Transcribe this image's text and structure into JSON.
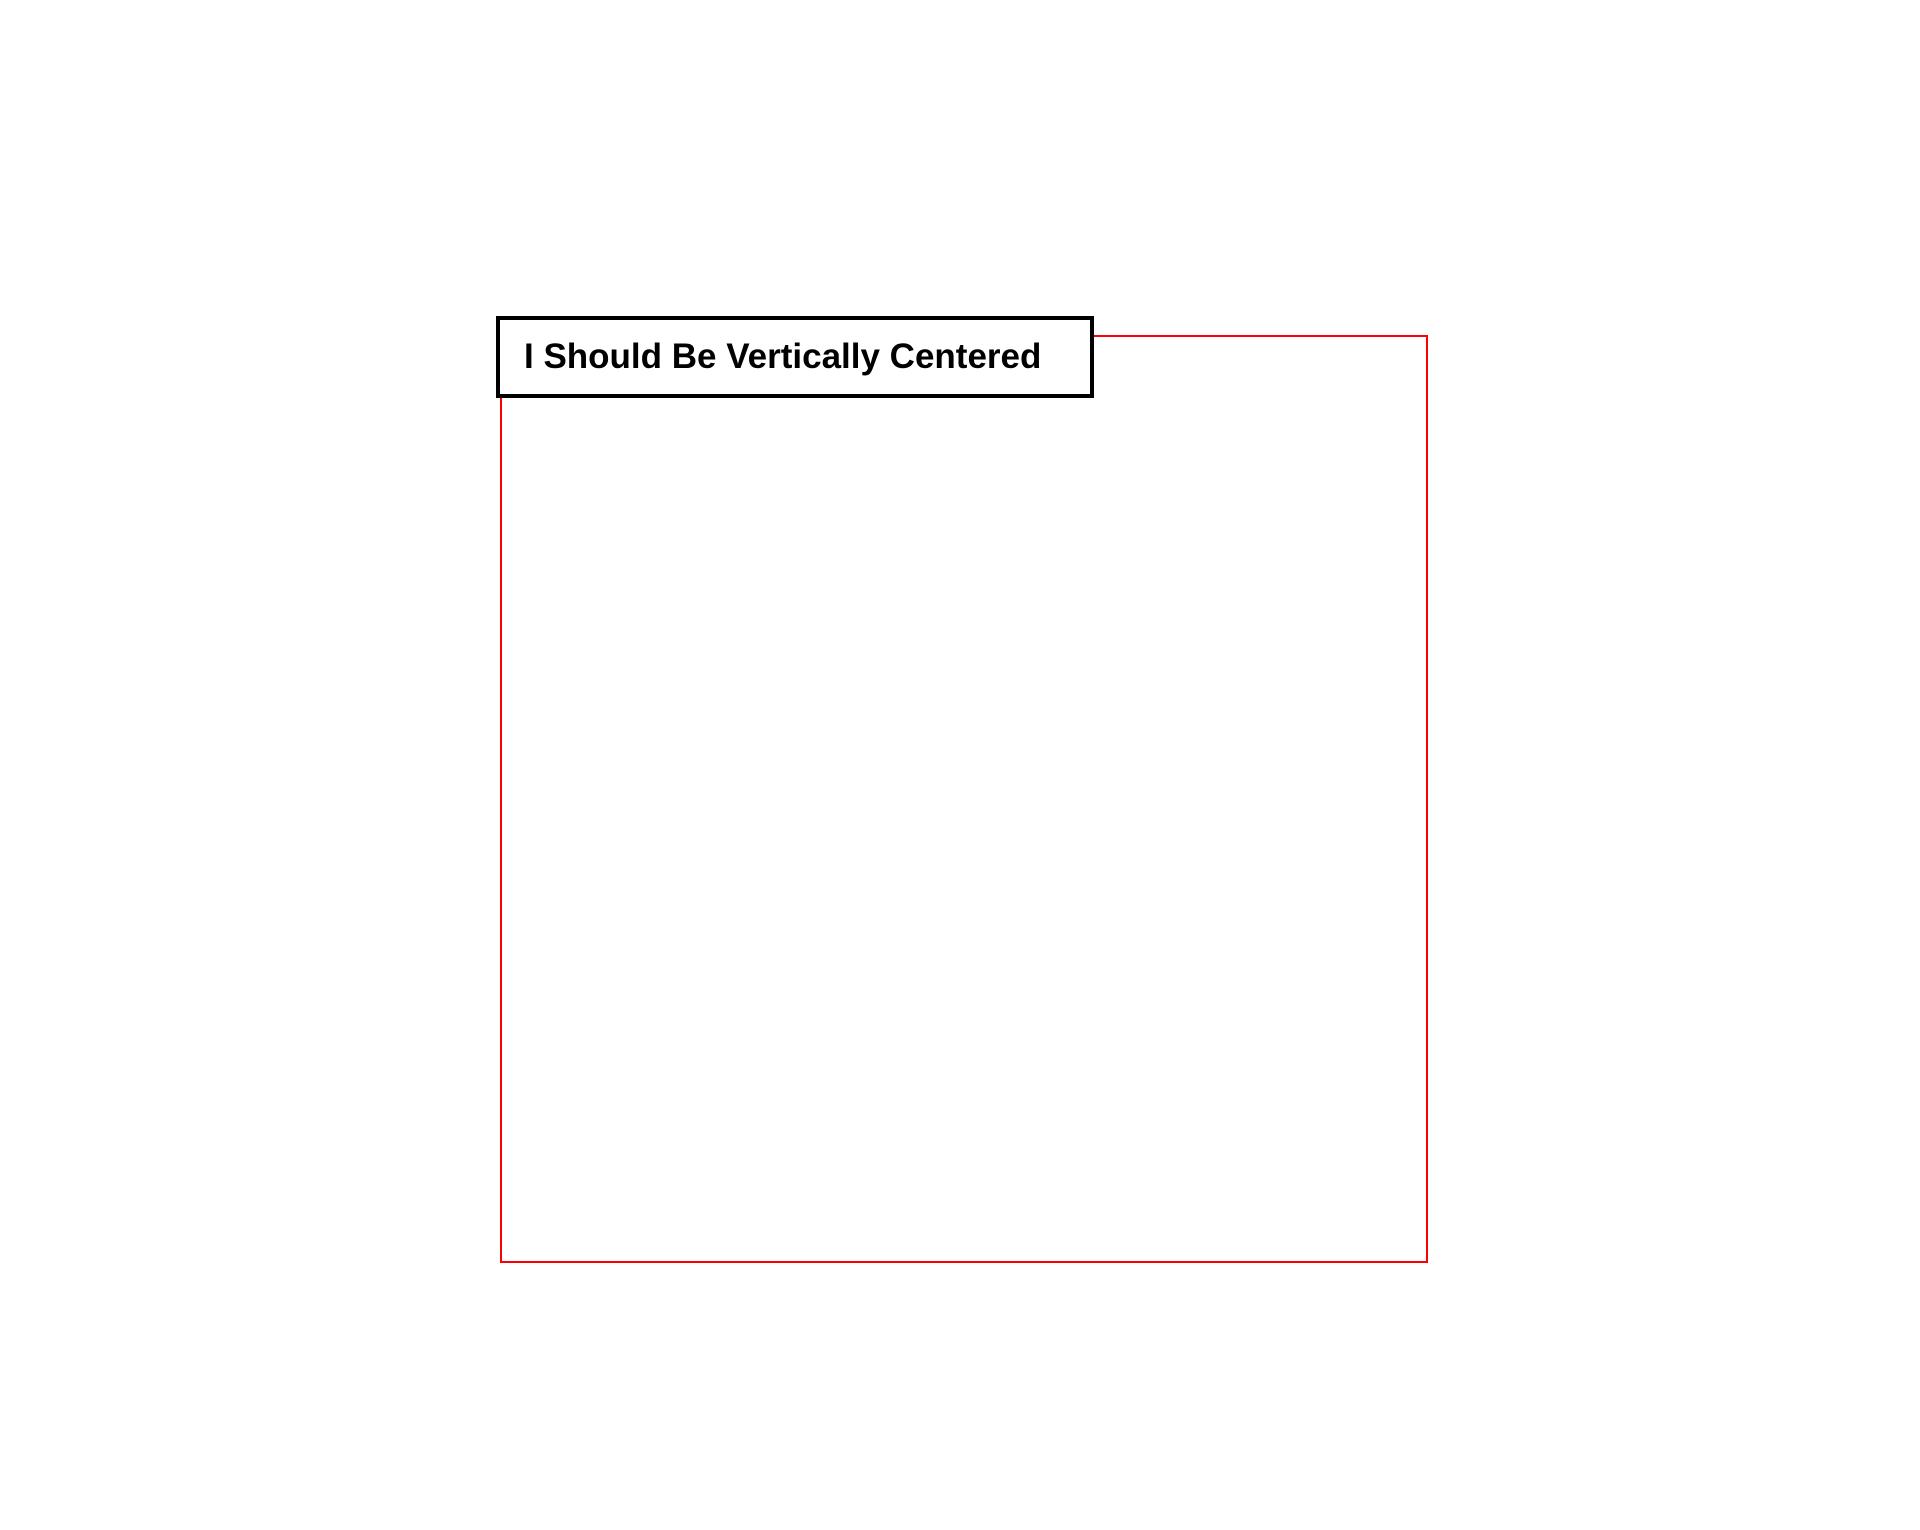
{
  "box": {
    "label": "I Should Be Vertically Centered"
  },
  "colors": {
    "outer_border": "#ff0000",
    "inner_border": "#000000",
    "background": "#ffffff",
    "text": "#000000"
  }
}
